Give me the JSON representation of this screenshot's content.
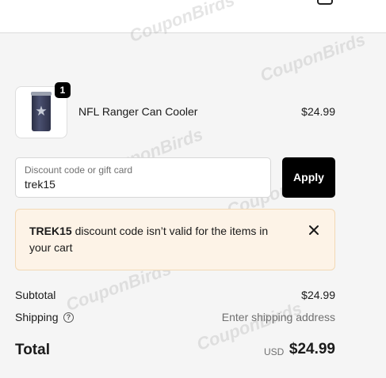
{
  "product": {
    "name": "NFL Ranger Can Cooler",
    "price": "$24.99",
    "quantity": "1"
  },
  "discount": {
    "label": "Discount code or gift card",
    "value": "trek15",
    "apply_label": "Apply"
  },
  "error": {
    "code": "TREK15",
    "message": " discount code isn’t valid for the items in your cart"
  },
  "summary": {
    "subtotal_label": "Subtotal",
    "subtotal_value": "$24.99",
    "shipping_label": "Shipping",
    "shipping_value": "Enter shipping address",
    "total_label": "Total",
    "currency": "USD",
    "total_value": "$24.99"
  },
  "watermark": "CouponBirds",
  "colors": {
    "accent": "#000000",
    "error_bg": "#fdf3e7",
    "error_border": "#f2d9b5"
  }
}
